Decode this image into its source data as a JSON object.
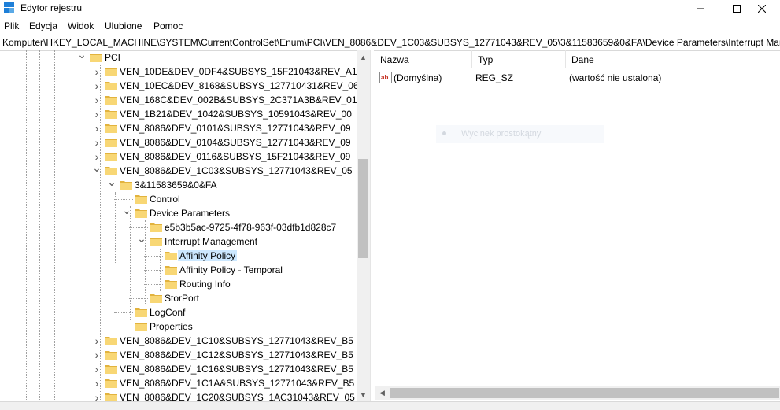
{
  "window": {
    "title": "Edytor rejestru"
  },
  "menu": [
    "Plik",
    "Edycja",
    "Widok",
    "Ulubione",
    "Pomoc"
  ],
  "address": "Komputer\\HKEY_LOCAL_MACHINE\\SYSTEM\\CurrentControlSet\\Enum\\PCI\\VEN_8086&DEV_1C03&SUBSYS_12771043&REV_05\\3&11583659&0&FA\\Device Parameters\\Interrupt Management\\Affinity Policy",
  "tree": [
    {
      "label": "PCI",
      "level": 0,
      "expander": "down"
    },
    {
      "label": "VEN_10DE&DEV_0DF4&SUBSYS_15F21043&REV_A1",
      "level": 1,
      "expander": "right"
    },
    {
      "label": "VEN_10EC&DEV_8168&SUBSYS_127710431&REV_06",
      "level": 1,
      "expander": "right"
    },
    {
      "label": "VEN_168C&DEV_002B&SUBSYS_2C371A3B&REV_01",
      "level": 1,
      "expander": "right"
    },
    {
      "label": "VEN_1B21&DEV_1042&SUBSYS_10591043&REV_00",
      "level": 1,
      "expander": "right"
    },
    {
      "label": "VEN_8086&DEV_0101&SUBSYS_12771043&REV_09",
      "level": 1,
      "expander": "right"
    },
    {
      "label": "VEN_8086&DEV_0104&SUBSYS_12771043&REV_09",
      "level": 1,
      "expander": "right"
    },
    {
      "label": "VEN_8086&DEV_0116&SUBSYS_15F21043&REV_09",
      "level": 1,
      "expander": "right"
    },
    {
      "label": "VEN_8086&DEV_1C03&SUBSYS_12771043&REV_05",
      "level": 1,
      "expander": "down"
    },
    {
      "label": "3&11583659&0&FA",
      "level": 2,
      "expander": "down"
    },
    {
      "label": "Control",
      "level": 3,
      "expander": ""
    },
    {
      "label": "Device Parameters",
      "level": 3,
      "expander": "down"
    },
    {
      "label": "e5b3b5ac-9725-4f78-963f-03dfb1d828c7",
      "level": 4,
      "expander": ""
    },
    {
      "label": "Interrupt Management",
      "level": 4,
      "expander": "down"
    },
    {
      "label": "Affinity Policy",
      "level": 5,
      "expander": "",
      "selected": true
    },
    {
      "label": "Affinity Policy - Temporal",
      "level": 5,
      "expander": ""
    },
    {
      "label": "Routing Info",
      "level": 5,
      "expander": ""
    },
    {
      "label": "StorPort",
      "level": 4,
      "expander": ""
    },
    {
      "label": "LogConf",
      "level": 3,
      "expander": ""
    },
    {
      "label": "Properties",
      "level": 3,
      "expander": ""
    },
    {
      "label": "VEN_8086&DEV_1C10&SUBSYS_12771043&REV_B5",
      "level": 1,
      "expander": "right"
    },
    {
      "label": "VEN_8086&DEV_1C12&SUBSYS_12771043&REV_B5",
      "level": 1,
      "expander": "right"
    },
    {
      "label": "VEN_8086&DEV_1C16&SUBSYS_12771043&REV_B5",
      "level": 1,
      "expander": "right"
    },
    {
      "label": "VEN_8086&DEV_1C1A&SUBSYS_12771043&REV_B5",
      "level": 1,
      "expander": "right"
    },
    {
      "label": "VEN_8086&DEV_1C20&SUBSYS_1AC31043&REV_05",
      "level": 1,
      "expander": "right"
    }
  ],
  "columns": {
    "name": "Nazwa",
    "type": "Typ",
    "data": "Dane"
  },
  "values": [
    {
      "name": "(Domyślna)",
      "type": "REG_SZ",
      "data": "(wartość nie ustalona)"
    }
  ],
  "ghost_tooltip": "Wycinek prostokątny",
  "colors": {
    "folder": "#f8d775",
    "folder_dark": "#e2b33e",
    "selection": "#cce8ff"
  }
}
